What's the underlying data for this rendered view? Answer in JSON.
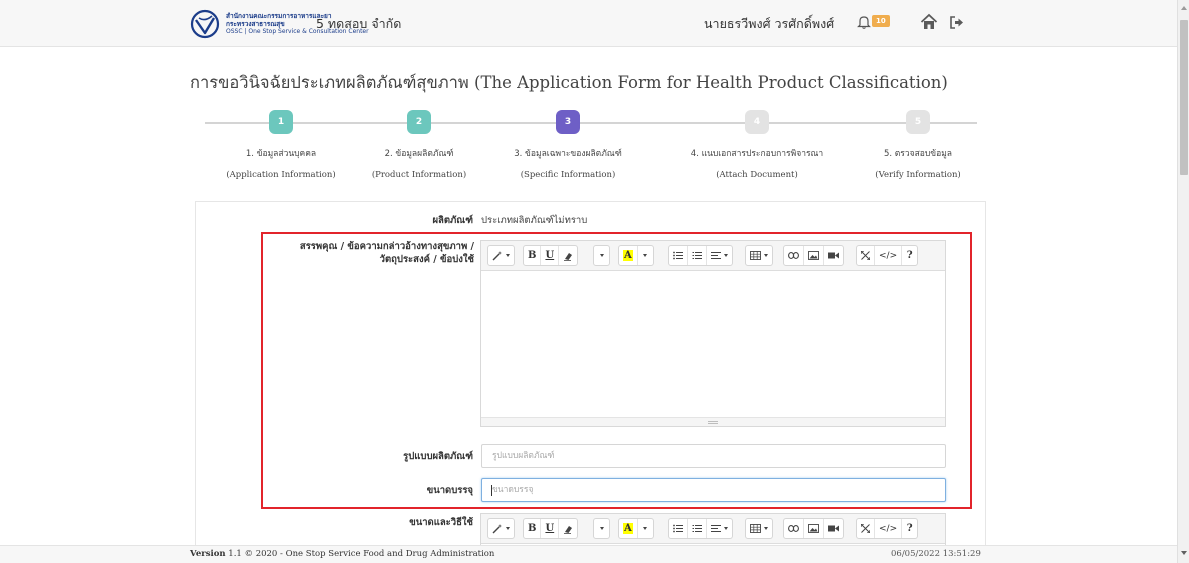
{
  "header": {
    "org_name_th": "สำนักงานคณะกรรมการอาหารและยา",
    "ministry_th": "กระทรวงสาธารณสุข",
    "org_line": "OSSC | One Stop Service & Consultation Center",
    "company": "5 ทดสอบ จำกัด",
    "user_name": "นายธรวีพงศ์ วรศักดิ์พงศ์",
    "notification_count": "10"
  },
  "page": {
    "title": "การขอวินิจฉัยประเภทผลิตภัณฑ์สุขภาพ (The Application Form for Health Product Classification)"
  },
  "wizard": {
    "steps": [
      {
        "number": "1",
        "label": "1. ข้อมูลส่วนบุคคล",
        "sub": "(Application Information)",
        "state": "done"
      },
      {
        "number": "2",
        "label": "2. ข้อมูลผลิตภัณฑ์",
        "sub": "(Product Information)",
        "state": "done"
      },
      {
        "number": "3",
        "label": "3. ข้อมูลเฉพาะของผลิตภัณฑ์",
        "sub": "(Specific Information)",
        "state": "active"
      },
      {
        "number": "4",
        "label": "4. แนบเอกสารประกอบการพิจารณา",
        "sub": "(Attach Document)",
        "state": "todo"
      },
      {
        "number": "5",
        "label": "5. ตรวจสอบข้อมูล",
        "sub": "(Verify Information)",
        "state": "todo"
      }
    ]
  },
  "form": {
    "product_label": "ผลิตภัณฑ์",
    "product_value": "ประเภทผลิตภัณฑ์ไม่ทราบ",
    "properties_label_line1": "สรรพคุณ / ข้อความกล่าวอ้างทางสุขภาพ /",
    "properties_label_line2": "วัตถุประสงค์ / ข้อบ่งใช้",
    "form_label": "รูปแบบผลิตภัณฑ์",
    "form_placeholder": "รูปแบบผลิตภัณฑ์",
    "package_label": "ขนาดบรรจุ",
    "package_placeholder": "ขนาดบรรจุ",
    "usage_label": "ขนาดและวิธีใช้"
  },
  "toolbar": {
    "magic": "magic-icon",
    "bold": "B",
    "underline": "U",
    "eraser": "eraser-icon",
    "font_size": "font-size-dropdown",
    "color": "A",
    "ul": "unordered-list-icon",
    "ol": "ordered-list-icon",
    "align": "paragraph-align-icon",
    "table": "table-icon",
    "link": "link-icon",
    "picture": "picture-icon",
    "video": "video-icon",
    "fullscreen": "fullscreen-icon",
    "code": "</>",
    "help": "?"
  },
  "footer": {
    "version_label": "Version",
    "version_text": "1.1 © 2020 - One Stop Service Food and Drug Administration",
    "datetime": "06/05/2022 13:51:29"
  },
  "colors": {
    "step_done": "#6cc7bd",
    "step_active": "#6e5fc6",
    "step_todo": "#e3e3e3",
    "highlight_border": "#e2242b",
    "logo_blue": "#1c3d8a"
  }
}
